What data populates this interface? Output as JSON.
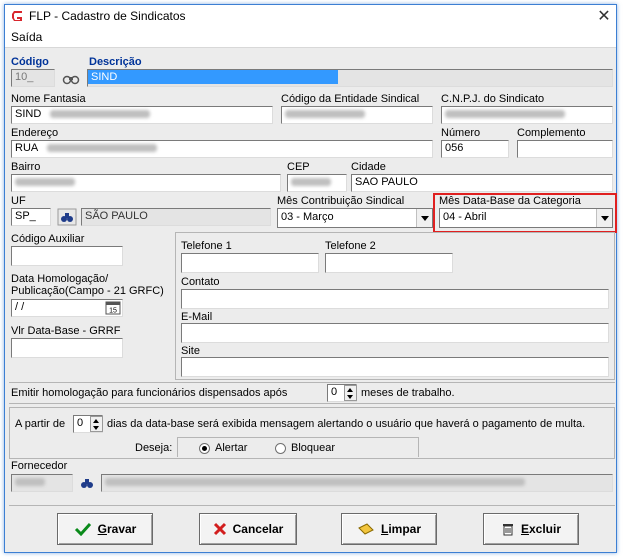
{
  "window": {
    "title": "FLP - Cadastro de Sindicatos",
    "close_glyph": "✕",
    "app_icon": "flp-logo-icon"
  },
  "menu": {
    "items": [
      {
        "label": "Saída"
      }
    ]
  },
  "codigo": {
    "label": "Código",
    "value": "10_"
  },
  "descricao": {
    "label": "Descrição",
    "value": "SIND"
  },
  "nome_fantasia": {
    "label": "Nome Fantasia",
    "value": "SIND"
  },
  "codigo_entidade": {
    "label": "Código da Entidade Sindical",
    "value": ""
  },
  "cnpj": {
    "label": "C.N.P.J. do Sindicato",
    "value": ""
  },
  "endereco": {
    "label": "Endereço",
    "value": "RUA"
  },
  "numero": {
    "label": "Número",
    "value": "056"
  },
  "complemento": {
    "label": "Complemento",
    "value": ""
  },
  "bairro": {
    "label": "Bairro",
    "value": ""
  },
  "cep": {
    "label": "CEP",
    "value": ""
  },
  "cidade": {
    "label": "Cidade",
    "value": "SAO PAULO"
  },
  "uf": {
    "label": "UF",
    "value": "SP_",
    "state_name": "SÃO PAULO"
  },
  "mes_contribuicao": {
    "label": "Mês Contribuição Sindical",
    "value": "03 - Março"
  },
  "mes_database": {
    "label": "Mês Data-Base da Categoria",
    "value": "04 - Abril"
  },
  "codigo_auxiliar": {
    "label": "Código Auxiliar",
    "value": ""
  },
  "data_homologacao": {
    "label_line1": "Data Homologação/",
    "label_line2": "Publicação(Campo - 21 GRFC)",
    "value": " / /"
  },
  "vlr_database": {
    "label": "Vlr Data-Base - GRRF",
    "value": ""
  },
  "contact": {
    "telefone1_label": "Telefone 1",
    "telefone2_label": "Telefone 2",
    "contato_label": "Contato",
    "email_label": "E-Mail",
    "site_label": "Site"
  },
  "homologacao": {
    "prefix": "Emitir homologação para funcionários dispensados após",
    "value": "0",
    "suffix": "meses de trabalho."
  },
  "alerta": {
    "prefix": "A partir de",
    "value": "0",
    "suffix": "dias da data-base será exibida mensagem alertando o usuário que haverá o pagamento de multa.",
    "deseja_label": "Deseja:",
    "option_alertar": "Alertar",
    "option_bloquear": "Bloquear",
    "selected": "Alertar"
  },
  "fornecedor": {
    "label": "Fornecedor"
  },
  "buttons": {
    "gravar": {
      "underlined": "G",
      "rest": "ravar"
    },
    "cancelar": {
      "label": "Cancelar"
    },
    "limpar": {
      "underlined": "L",
      "rest": "impar"
    },
    "excluir": {
      "underlined": "E",
      "rest": "xcluir"
    }
  },
  "colors": {
    "accent_border": "#3c7fd3",
    "highlight": "#e02020",
    "selection": "#3399ff"
  }
}
